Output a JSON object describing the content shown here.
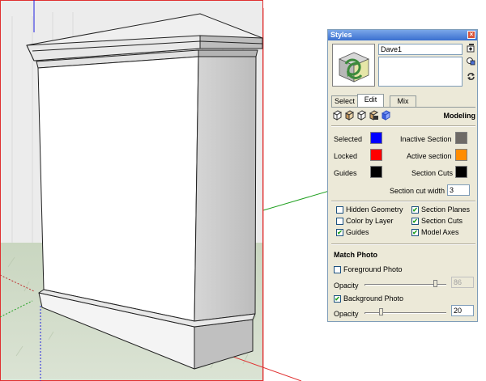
{
  "panel": {
    "title": "Styles",
    "close_glyph": "×"
  },
  "style": {
    "name": "Dave1",
    "description": ""
  },
  "icons": {
    "thumbnail": "style-cube-thumbnail-icon",
    "create_style": "create-style-icon",
    "update_style": "update-style-icon",
    "refresh": "refresh-icon"
  },
  "tabs": [
    {
      "label": "Select"
    },
    {
      "label": "Edit"
    },
    {
      "label": "Mix"
    }
  ],
  "active_tab": "Edit",
  "edit_section": "Modeling",
  "edit_section_icons": [
    "edge-settings-icon",
    "face-settings-icon",
    "background-settings-icon",
    "watermark-settings-icon",
    "modeling-settings-icon"
  ],
  "colors": {
    "selected": {
      "label": "Selected",
      "color": "#0000ff"
    },
    "locked": {
      "label": "Locked",
      "color": "#ff0000"
    },
    "guides": {
      "label": "Guides",
      "color": "#000000"
    },
    "inactive_section": {
      "label": "Inactive Section",
      "color": "#6e6a66"
    },
    "active_section": {
      "label": "Active section",
      "color": "#ff8c00"
    },
    "section_cuts": {
      "label": "Section Cuts",
      "color": "#000000"
    }
  },
  "section_cut_width": {
    "label": "Section cut width",
    "value": "3"
  },
  "checkboxes": {
    "hidden_geometry": {
      "label": "Hidden Geometry",
      "checked": false
    },
    "color_by_layer": {
      "label": "Color by Layer",
      "checked": false
    },
    "guides": {
      "label": "Guides",
      "checked": true
    },
    "section_planes": {
      "label": "Section Planes",
      "checked": true
    },
    "section_cuts": {
      "label": "Section Cuts",
      "checked": true
    },
    "model_axes": {
      "label": "Model Axes",
      "checked": true
    }
  },
  "match_photo": {
    "title": "Match Photo",
    "foreground": {
      "label": "Foreground Photo",
      "checked": false,
      "opacity_label": "Opacity",
      "opacity": "86",
      "opacity_fraction": 0.86
    },
    "background": {
      "label": "Background Photo",
      "checked": true,
      "opacity_label": "Opacity",
      "opacity": "20",
      "opacity_fraction": 0.2
    }
  },
  "axis_colors": {
    "red": "#e03030",
    "green": "#20a020",
    "blue": "#2020e0"
  }
}
